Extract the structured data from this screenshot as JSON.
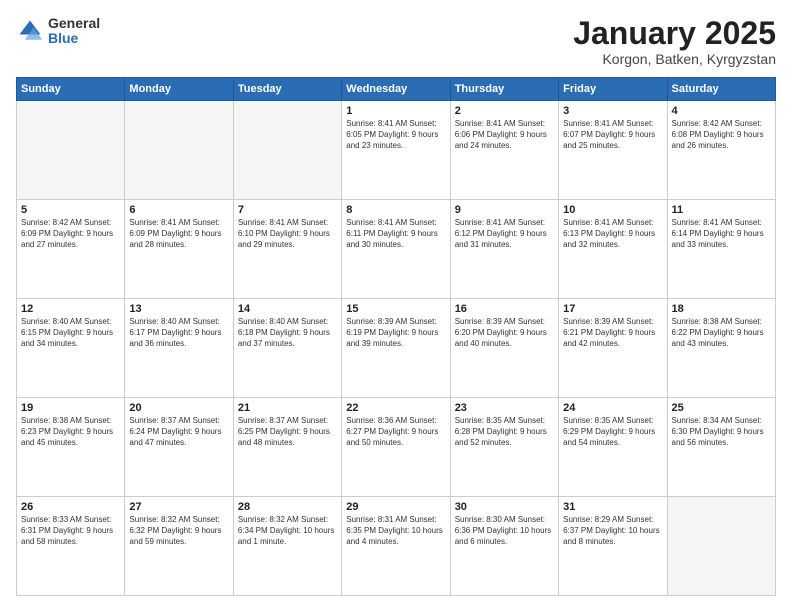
{
  "logo": {
    "general": "General",
    "blue": "Blue"
  },
  "header": {
    "title": "January 2025",
    "subtitle": "Korgon, Batken, Kyrgyzstan"
  },
  "weekdays": [
    "Sunday",
    "Monday",
    "Tuesday",
    "Wednesday",
    "Thursday",
    "Friday",
    "Saturday"
  ],
  "weeks": [
    [
      {
        "day": "",
        "info": ""
      },
      {
        "day": "",
        "info": ""
      },
      {
        "day": "",
        "info": ""
      },
      {
        "day": "1",
        "info": "Sunrise: 8:41 AM\nSunset: 6:05 PM\nDaylight: 9 hours\nand 23 minutes."
      },
      {
        "day": "2",
        "info": "Sunrise: 8:41 AM\nSunset: 6:06 PM\nDaylight: 9 hours\nand 24 minutes."
      },
      {
        "day": "3",
        "info": "Sunrise: 8:41 AM\nSunset: 6:07 PM\nDaylight: 9 hours\nand 25 minutes."
      },
      {
        "day": "4",
        "info": "Sunrise: 8:42 AM\nSunset: 6:08 PM\nDaylight: 9 hours\nand 26 minutes."
      }
    ],
    [
      {
        "day": "5",
        "info": "Sunrise: 8:42 AM\nSunset: 6:09 PM\nDaylight: 9 hours\nand 27 minutes."
      },
      {
        "day": "6",
        "info": "Sunrise: 8:41 AM\nSunset: 6:09 PM\nDaylight: 9 hours\nand 28 minutes."
      },
      {
        "day": "7",
        "info": "Sunrise: 8:41 AM\nSunset: 6:10 PM\nDaylight: 9 hours\nand 29 minutes."
      },
      {
        "day": "8",
        "info": "Sunrise: 8:41 AM\nSunset: 6:11 PM\nDaylight: 9 hours\nand 30 minutes."
      },
      {
        "day": "9",
        "info": "Sunrise: 8:41 AM\nSunset: 6:12 PM\nDaylight: 9 hours\nand 31 minutes."
      },
      {
        "day": "10",
        "info": "Sunrise: 8:41 AM\nSunset: 6:13 PM\nDaylight: 9 hours\nand 32 minutes."
      },
      {
        "day": "11",
        "info": "Sunrise: 8:41 AM\nSunset: 6:14 PM\nDaylight: 9 hours\nand 33 minutes."
      }
    ],
    [
      {
        "day": "12",
        "info": "Sunrise: 8:40 AM\nSunset: 6:15 PM\nDaylight: 9 hours\nand 34 minutes."
      },
      {
        "day": "13",
        "info": "Sunrise: 8:40 AM\nSunset: 6:17 PM\nDaylight: 9 hours\nand 36 minutes."
      },
      {
        "day": "14",
        "info": "Sunrise: 8:40 AM\nSunset: 6:18 PM\nDaylight: 9 hours\nand 37 minutes."
      },
      {
        "day": "15",
        "info": "Sunrise: 8:39 AM\nSunset: 6:19 PM\nDaylight: 9 hours\nand 39 minutes."
      },
      {
        "day": "16",
        "info": "Sunrise: 8:39 AM\nSunset: 6:20 PM\nDaylight: 9 hours\nand 40 minutes."
      },
      {
        "day": "17",
        "info": "Sunrise: 8:39 AM\nSunset: 6:21 PM\nDaylight: 9 hours\nand 42 minutes."
      },
      {
        "day": "18",
        "info": "Sunrise: 8:38 AM\nSunset: 6:22 PM\nDaylight: 9 hours\nand 43 minutes."
      }
    ],
    [
      {
        "day": "19",
        "info": "Sunrise: 8:38 AM\nSunset: 6:23 PM\nDaylight: 9 hours\nand 45 minutes."
      },
      {
        "day": "20",
        "info": "Sunrise: 8:37 AM\nSunset: 6:24 PM\nDaylight: 9 hours\nand 47 minutes."
      },
      {
        "day": "21",
        "info": "Sunrise: 8:37 AM\nSunset: 6:25 PM\nDaylight: 9 hours\nand 48 minutes."
      },
      {
        "day": "22",
        "info": "Sunrise: 8:36 AM\nSunset: 6:27 PM\nDaylight: 9 hours\nand 50 minutes."
      },
      {
        "day": "23",
        "info": "Sunrise: 8:35 AM\nSunset: 6:28 PM\nDaylight: 9 hours\nand 52 minutes."
      },
      {
        "day": "24",
        "info": "Sunrise: 8:35 AM\nSunset: 6:29 PM\nDaylight: 9 hours\nand 54 minutes."
      },
      {
        "day": "25",
        "info": "Sunrise: 8:34 AM\nSunset: 6:30 PM\nDaylight: 9 hours\nand 56 minutes."
      }
    ],
    [
      {
        "day": "26",
        "info": "Sunrise: 8:33 AM\nSunset: 6:31 PM\nDaylight: 9 hours\nand 58 minutes."
      },
      {
        "day": "27",
        "info": "Sunrise: 8:32 AM\nSunset: 6:32 PM\nDaylight: 9 hours\nand 59 minutes."
      },
      {
        "day": "28",
        "info": "Sunrise: 8:32 AM\nSunset: 6:34 PM\nDaylight: 10 hours\nand 1 minute."
      },
      {
        "day": "29",
        "info": "Sunrise: 8:31 AM\nSunset: 6:35 PM\nDaylight: 10 hours\nand 4 minutes."
      },
      {
        "day": "30",
        "info": "Sunrise: 8:30 AM\nSunset: 6:36 PM\nDaylight: 10 hours\nand 6 minutes."
      },
      {
        "day": "31",
        "info": "Sunrise: 8:29 AM\nSunset: 6:37 PM\nDaylight: 10 hours\nand 8 minutes."
      },
      {
        "day": "",
        "info": ""
      }
    ]
  ]
}
